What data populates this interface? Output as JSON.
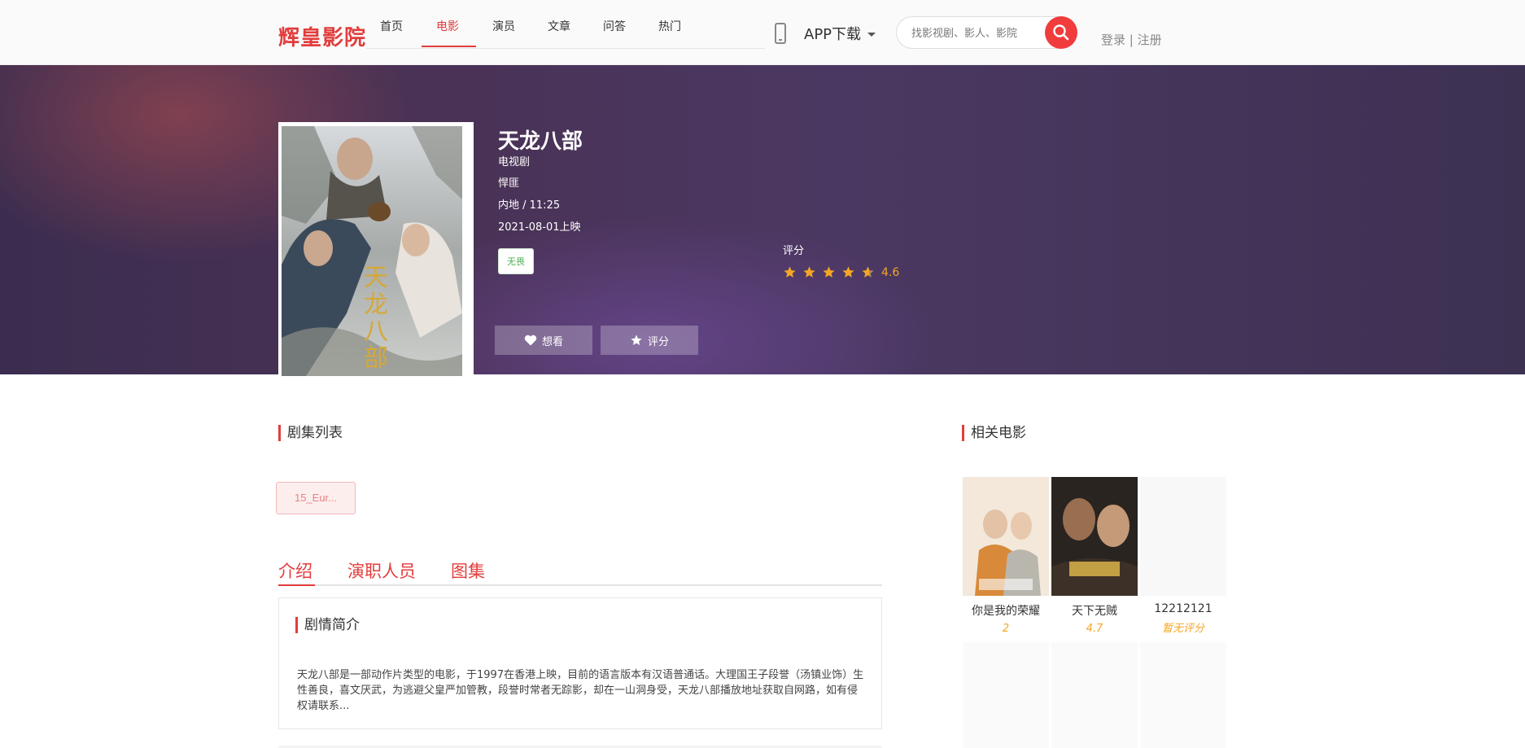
{
  "header": {
    "logo": "辉皇影院",
    "nav": [
      {
        "label": "首页"
      },
      {
        "label": "电影"
      },
      {
        "label": "演员"
      },
      {
        "label": "文章"
      },
      {
        "label": "问答"
      },
      {
        "label": "热门"
      }
    ],
    "active_nav": "电影",
    "app_download": "APP下载",
    "search_placeholder": "找影视剧、影人、影院",
    "login": "登录",
    "separator": "|",
    "register": "注册"
  },
  "movie": {
    "title": "天龙八部",
    "poster_text": "天龙八部",
    "category": "电视剧",
    "genre": "悍匪",
    "region_duration": "内地 / 11:25",
    "release": "2021-08-01上映",
    "tag": "无畏",
    "want_label": "想看",
    "rate_label": "评分",
    "rating_label": "评分",
    "rating_score": "4.6",
    "rating_value": 4.6,
    "rating_max": 5
  },
  "episodes": {
    "title": "剧集列表",
    "items": [
      "15_Eur..."
    ]
  },
  "tabs": [
    {
      "label": "介绍"
    },
    {
      "label": "演职人员"
    },
    {
      "label": "图集"
    }
  ],
  "synopsis": {
    "title": "剧情简介",
    "text": "天龙八部是一部动作片类型的电影，于1997在香港上映，目前的语言版本有汉语普通话。大理国王子段誉（汤镇业饰）生性善良，喜文厌武，为逃避父皇严加管教，段誉时常者无踪影，却在一山洞身受，天龙八部播放地址获取自网路，如有侵权请联系..."
  },
  "related": {
    "title": "相关电影",
    "items": [
      {
        "name": "你是我的荣耀",
        "score": "2",
        "poster_text": "你是我的荣耀"
      },
      {
        "name": "天下无贼",
        "score": "4.7",
        "poster_text": "天下无贼"
      },
      {
        "name": "12212121",
        "score": "暂无评分",
        "poster_text": ""
      }
    ]
  },
  "colors": {
    "accent": "#e23d3d",
    "star": "#f5a623",
    "tag_green": "#4caf50"
  }
}
